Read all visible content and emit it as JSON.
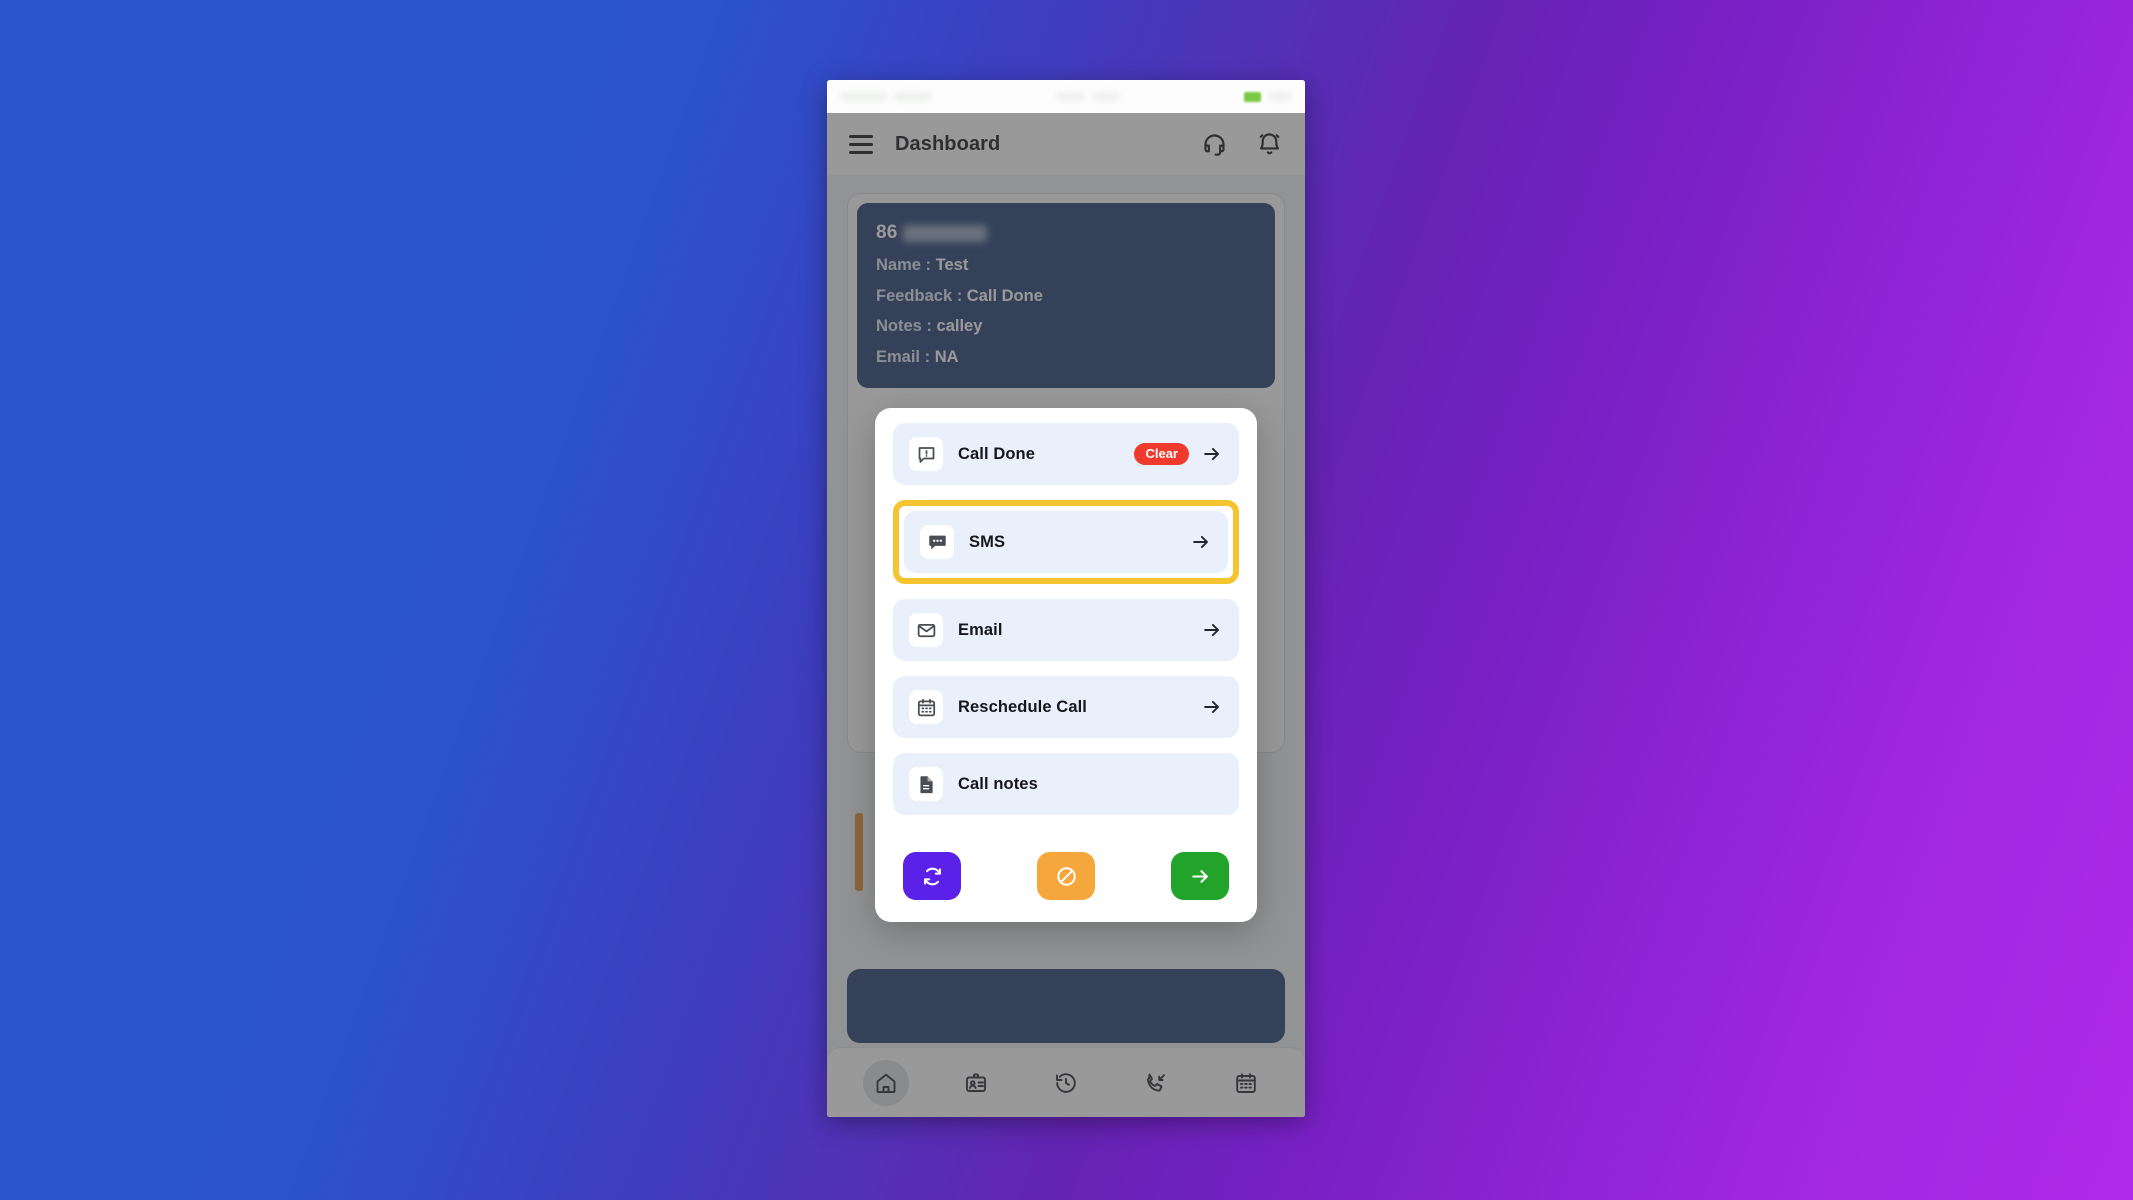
{
  "background": {
    "from": "#2a56cc",
    "to": "#ae2ae8"
  },
  "status_bar": {
    "battery_icon": "battery-icon",
    "redacted": true
  },
  "app_bar": {
    "menu_icon": "hamburger-menu-icon",
    "title": "Dashboard",
    "support_icon": "headset-support-icon",
    "notification_icon": "notification-bell-icon"
  },
  "lead_card": {
    "id": "86",
    "id_masked": true,
    "rows": [
      {
        "label": "Name :",
        "value": "Test"
      },
      {
        "label": "Feedback :",
        "value": "Call Done"
      },
      {
        "label": "Notes :",
        "value": "calley"
      },
      {
        "label": "Email :",
        "value": "NA"
      }
    ]
  },
  "action_sheet": {
    "highlight_color": "#f5c431",
    "options": [
      {
        "icon": "comment-alert-icon",
        "label": "Call Done",
        "badge": "Clear",
        "badge_color": "#f03a2e",
        "has_arrow": true,
        "highlighted": false
      },
      {
        "icon": "sms-chat-icon",
        "label": "SMS",
        "badge": null,
        "has_arrow": true,
        "highlighted": true
      },
      {
        "icon": "envelope-icon",
        "label": "Email",
        "badge": null,
        "has_arrow": true,
        "highlighted": false
      },
      {
        "icon": "calendar-icon",
        "label": "Reschedule Call",
        "badge": null,
        "has_arrow": true,
        "highlighted": false
      },
      {
        "icon": "document-notes-icon",
        "label": "Call notes",
        "badge": null,
        "has_arrow": false,
        "highlighted": false
      }
    ],
    "buttons": [
      {
        "name": "refresh-button",
        "icon": "refresh-sync-icon",
        "color": "#5b21e8"
      },
      {
        "name": "block-button",
        "icon": "block-ban-icon",
        "color": "#f5a73c"
      },
      {
        "name": "next-button",
        "icon": "arrow-right-icon",
        "color": "#22a32a"
      }
    ]
  },
  "bottom_nav": {
    "items": [
      {
        "name": "nav-home",
        "icon": "home-icon",
        "active": true
      },
      {
        "name": "nav-contacts",
        "icon": "contact-card-icon",
        "active": false
      },
      {
        "name": "nav-history",
        "icon": "history-clock-icon",
        "active": false
      },
      {
        "name": "nav-calls",
        "icon": "call-incoming-icon",
        "active": false
      },
      {
        "name": "nav-calendar",
        "icon": "calendar-icon",
        "active": false
      }
    ]
  }
}
